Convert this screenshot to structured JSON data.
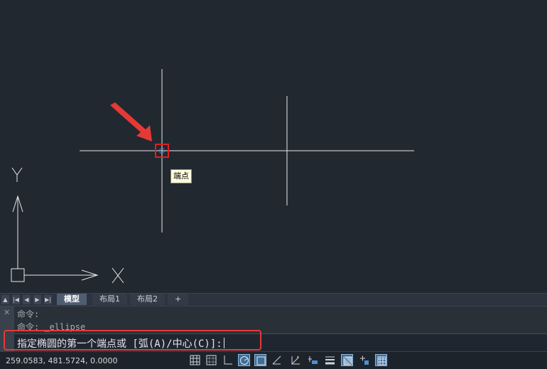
{
  "snap_tooltip": "端点",
  "ucs": {
    "x_label": "X",
    "y_label": "Y"
  },
  "tabs": [
    {
      "label": "模型",
      "active": true
    },
    {
      "label": "布局1",
      "active": false
    },
    {
      "label": "布局2",
      "active": false
    },
    {
      "label": "+",
      "active": false
    }
  ],
  "command": {
    "history": [
      "命令:",
      "命令: _ellipse"
    ],
    "prompt": "指定椭圆的第一个端点或 [弧(A)/中心(C)]:"
  },
  "status": {
    "coordinates": "259.0583, 481.5724, 0.0000",
    "icons": [
      {
        "name": "grid-display-icon",
        "on": false
      },
      {
        "name": "snap-mode-icon",
        "on": false
      },
      {
        "name": "ortho-mode-icon",
        "on": false
      },
      {
        "name": "polar-tracking-icon",
        "on": true
      },
      {
        "name": "object-snap-icon",
        "on": true
      },
      {
        "name": "object-snap-tracking-icon",
        "on": false
      },
      {
        "name": "dynamic-ucs-icon",
        "on": false
      },
      {
        "name": "dynamic-input-icon",
        "on": false
      },
      {
        "name": "lineweight-icon",
        "on": false
      },
      {
        "name": "transparency-icon",
        "on": true
      },
      {
        "name": "selection-cycling-icon",
        "on": false
      },
      {
        "name": "annotation-monitor-icon",
        "on": true
      }
    ]
  },
  "colors": {
    "canvas_bg": "#212830",
    "highlight_red": "#e33a3a",
    "toggle_on": "#3e6d9a"
  }
}
